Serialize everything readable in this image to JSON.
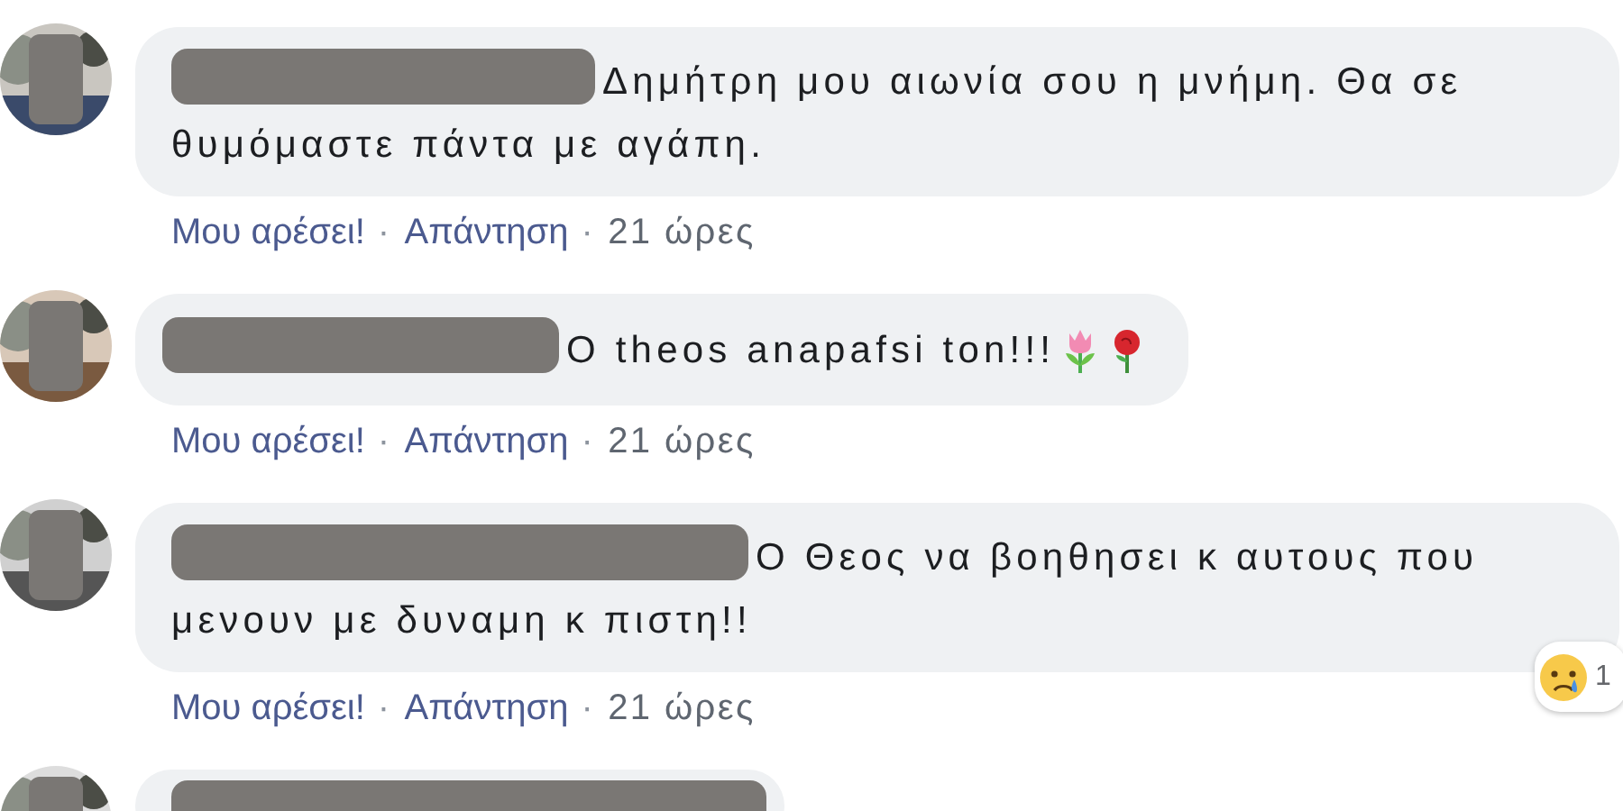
{
  "separator": "·",
  "comments": [
    {
      "kind": "text",
      "lines": [
        "Δημήτρη μου αιωνία σου η μνήμη. Θα σε",
        "θυμόμαστε πάντα με αγάπη."
      ],
      "actions": [
        {
          "kind": "link",
          "label": "Μου αρέσει!"
        },
        {
          "kind": "link",
          "label": "Απάντηση"
        },
        {
          "kind": "time",
          "label": "21 ώρες"
        }
      ]
    },
    {
      "kind": "text_flowers",
      "lines": [
        "O theos anapafsi ton!!!"
      ],
      "actions": [
        {
          "kind": "link",
          "label": "Μου αρέσει!"
        },
        {
          "kind": "link",
          "label": "Απάντηση"
        },
        {
          "kind": "time",
          "label": "21 ώρες"
        }
      ]
    },
    {
      "kind": "text",
      "lines": [
        "Ο Θεος να βοηθησει κ αυτους που",
        "μενουν με δυναμη κ πιστη!!"
      ],
      "reaction": {
        "count": "1"
      },
      "actions": [
        {
          "kind": "link",
          "label": "Μου αρέσει!"
        },
        {
          "kind": "link",
          "label": "Απάντηση"
        },
        {
          "kind": "time",
          "label": "21 ώρες"
        }
      ]
    },
    {
      "kind": "partial"
    }
  ]
}
